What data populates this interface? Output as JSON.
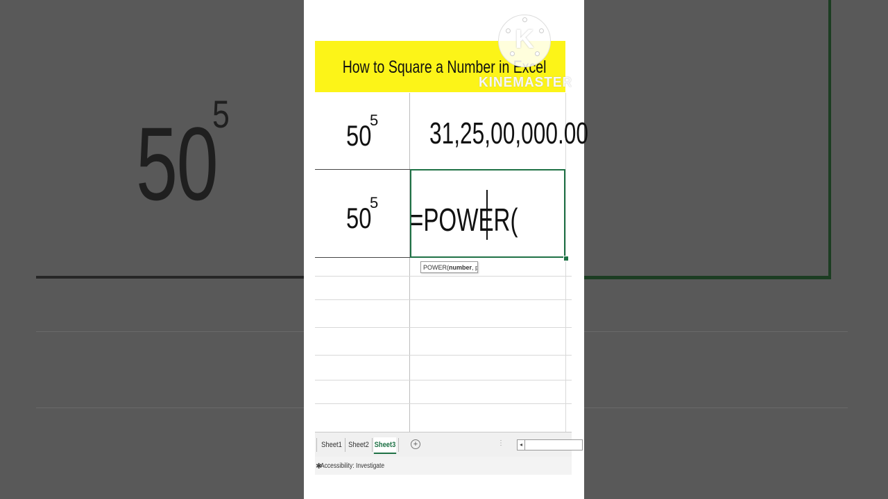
{
  "video_title": "How to Square a Number in Excel",
  "watermark": "KINEMASTER",
  "logo_letter": "K",
  "background": {
    "big_base": "50",
    "big_exponent": "5"
  },
  "cells": {
    "row1": {
      "base": "50",
      "exponent": "5",
      "value": "31,25,00,000.00"
    },
    "row2": {
      "base": "50",
      "exponent": "5",
      "formula": "=POWER("
    }
  },
  "tooltip": {
    "func": "POWER(",
    "arg1": "number",
    "rest": ", power)"
  },
  "sheet_tabs": [
    "Sheet1",
    "Sheet2",
    "Sheet3"
  ],
  "active_sheet": "Sheet3",
  "add_sheet_symbol": "+",
  "scroll_dots": "⋮",
  "scroll_left_arrow": "◂",
  "status": {
    "text": "Accessibility: Investigate",
    "icon": "accessibility-icon"
  },
  "colors": {
    "banner": "#fcf418",
    "accent_green": "#1e7145"
  }
}
